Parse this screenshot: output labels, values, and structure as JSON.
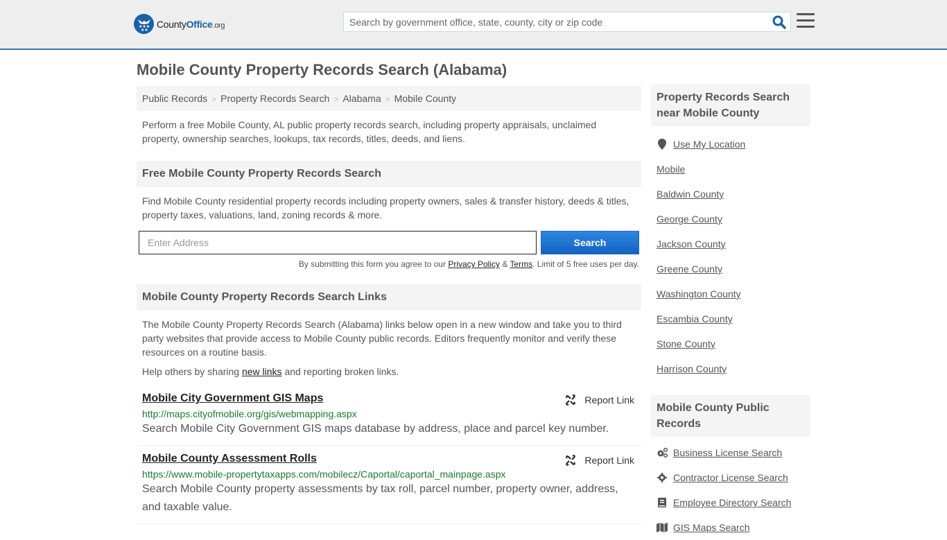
{
  "header": {
    "logo": {
      "brand_county": "County",
      "brand_office": "Office",
      "brand_tld": ".org"
    },
    "search": {
      "placeholder": "Search by government office, state, county, city or zip code",
      "icon": "search-icon"
    },
    "menu_icon": "hamburger-menu-icon",
    "colors": {
      "brand": "#1c5fa8",
      "accent_bar": "#3a7aad",
      "header_bg": "#eeeeee"
    }
  },
  "page": {
    "title": "Mobile County Property Records Search (Alabama)"
  },
  "breadcrumb": [
    {
      "label": "Public Records"
    },
    {
      "label": "Property Records Search"
    },
    {
      "label": "Alabama"
    },
    {
      "label": "Mobile County"
    }
  ],
  "breadcrumb_separator": ">",
  "intro": "Perform a free Mobile County, AL public property records search, including property appraisals, unclaimed property, ownership searches, lookups, tax records, titles, deeds, and liens.",
  "free_search": {
    "heading": "Free Mobile County Property Records Search",
    "description": "Find Mobile County residential property records including property owners, sales & transfer history, deeds & titles, property taxes, valuations, land, zoning records & more.",
    "address_placeholder": "Enter Address",
    "address_value": "",
    "submit_label": "Search",
    "disclaimer_before": "By submitting this form you agree to our ",
    "privacy_label": "Privacy Policy",
    "amp": " & ",
    "terms_label": "Terms",
    "disclaimer_after": ". Limit of 5 free uses per day."
  },
  "links_section": {
    "heading": "Mobile County Property Records Search Links",
    "description": "The Mobile County Property Records Search (Alabama) links below open in a new window and take you to third party websites that provide access to Mobile County public records. Editors frequently monitor and verify these resources on a routine basis.",
    "help_before": "Help others by sharing ",
    "help_link": "new links",
    "help_after": " and reporting broken links.",
    "report_label": "Report Link",
    "items": [
      {
        "title": "Mobile City Government GIS Maps",
        "url": "http://maps.cityofmobile.org/gis/webmapping.aspx",
        "description": "Search Mobile City Government GIS maps database by address, place and parcel key number."
      },
      {
        "title": "Mobile County Assessment Rolls",
        "url": "https://www.mobile-propertytaxapps.com/mobilecz/Caportal/caportal_mainpage.aspx",
        "description": "Search Mobile County property assessments by tax roll, parcel number, property owner, address, and taxable value."
      }
    ]
  },
  "sidebar": {
    "nearby": {
      "heading": "Property Records Search near Mobile County",
      "use_location": {
        "label": "Use My Location",
        "icon": "map-marker-icon"
      },
      "items": [
        {
          "label": "Mobile"
        },
        {
          "label": "Baldwin County"
        },
        {
          "label": "George County"
        },
        {
          "label": "Jackson County"
        },
        {
          "label": "Greene County"
        },
        {
          "label": "Washington County"
        },
        {
          "label": "Escambia County"
        },
        {
          "label": "Stone County"
        },
        {
          "label": "Harrison County"
        }
      ]
    },
    "public_records": {
      "heading": "Mobile County Public Records",
      "items": [
        {
          "label": "Business License Search",
          "icon": "cogs-icon"
        },
        {
          "label": "Contractor License Search",
          "icon": "gear-icon"
        },
        {
          "label": "Employee Directory Search",
          "icon": "book-icon"
        },
        {
          "label": "GIS Maps Search",
          "icon": "map-icon"
        }
      ]
    }
  }
}
